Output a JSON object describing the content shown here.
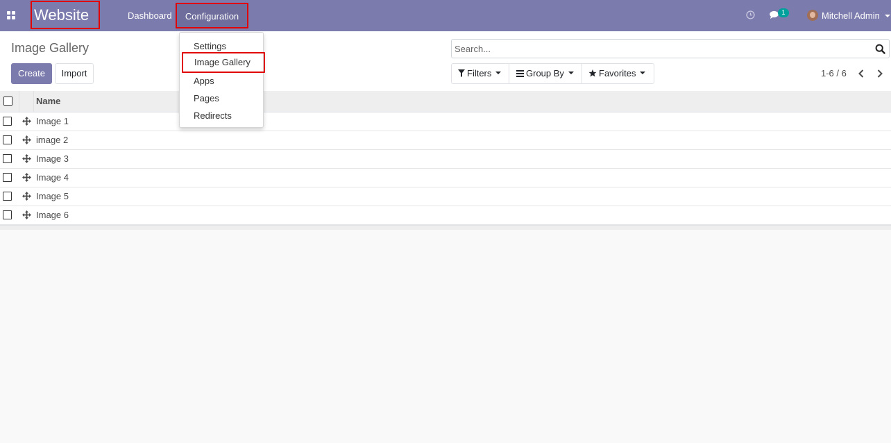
{
  "navbar": {
    "app_name": "Website",
    "menu": {
      "dashboard": "Dashboard",
      "configuration": "Configuration"
    },
    "chat_count": "1",
    "user_name": "Mitchell Admin",
    "accent_color": "#7c7bad"
  },
  "dropdown": {
    "items": [
      "Settings",
      "Image Gallery",
      "Apps",
      "Pages",
      "Redirects"
    ],
    "highlighted": "Image Gallery"
  },
  "control_panel": {
    "title": "Image Gallery",
    "create_label": "Create",
    "import_label": "Import",
    "search_placeholder": "Search...",
    "filters_label": "Filters",
    "groupby_label": "Group By",
    "favorites_label": "Favorites",
    "pager": "1-6 / 6"
  },
  "table": {
    "column_header": "Name",
    "rows": [
      "Image 1",
      "image 2",
      "Image 3",
      "Image 4",
      "Image 5",
      "Image 6"
    ]
  },
  "icons": {
    "apps": "apps-grid-icon",
    "clock": "clock-icon",
    "chat": "chat-icon",
    "search": "search-icon",
    "filter": "funnel-icon",
    "groupby": "bars-icon",
    "favorites": "star-icon",
    "handle": "move-arrows-icon"
  }
}
